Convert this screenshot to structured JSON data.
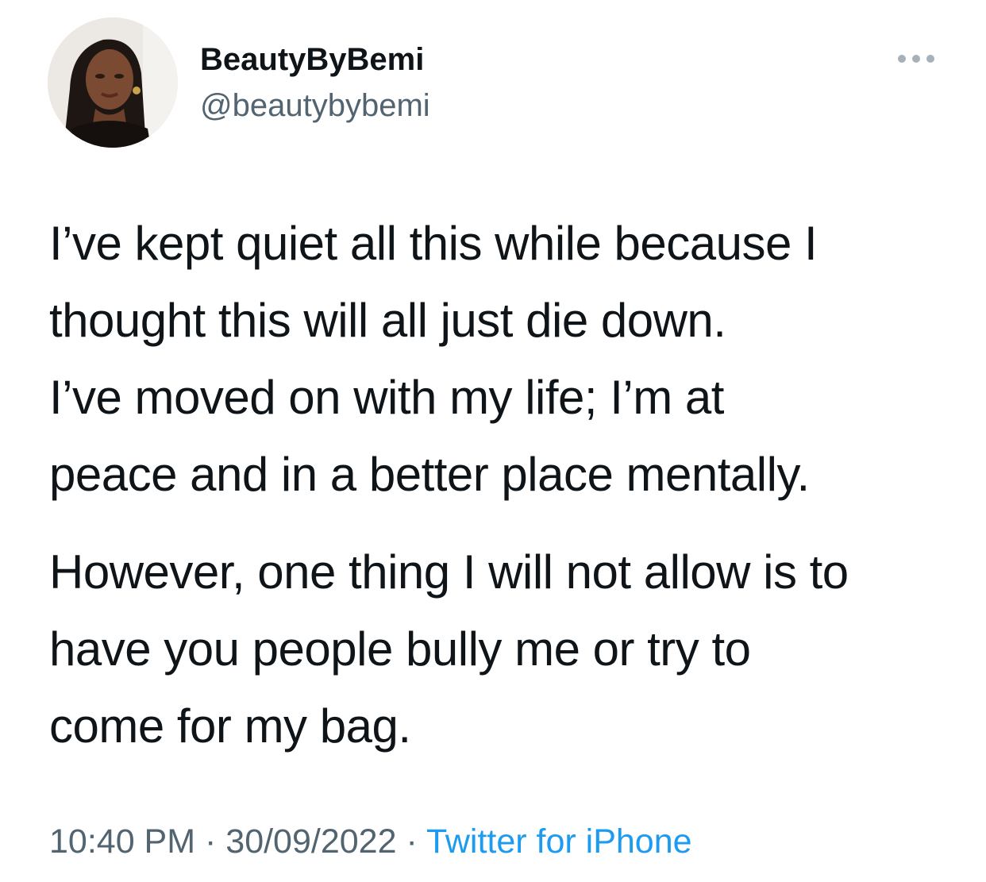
{
  "author": {
    "display_name": "BeautyByBemi",
    "handle": "@beautybybemi"
  },
  "menu_icon": "more-horizontal-icon",
  "tweet": {
    "paragraphs": [
      [
        "I’ve kept quiet all this while because I",
        "thought this will all just die down.",
        "I’ve moved on with my life; I’m at",
        "peace and in a better place mentally."
      ],
      [
        "However, one thing I will not allow is to",
        "have you people bully me or try to",
        "come for my bag."
      ]
    ]
  },
  "meta": {
    "time": "10:40 PM",
    "separator": " · ",
    "date": "30/09/2022",
    "source": "Twitter for iPhone"
  },
  "colors": {
    "text": "#0f1419",
    "secondary": "#536471",
    "link": "#1d9bf0"
  }
}
